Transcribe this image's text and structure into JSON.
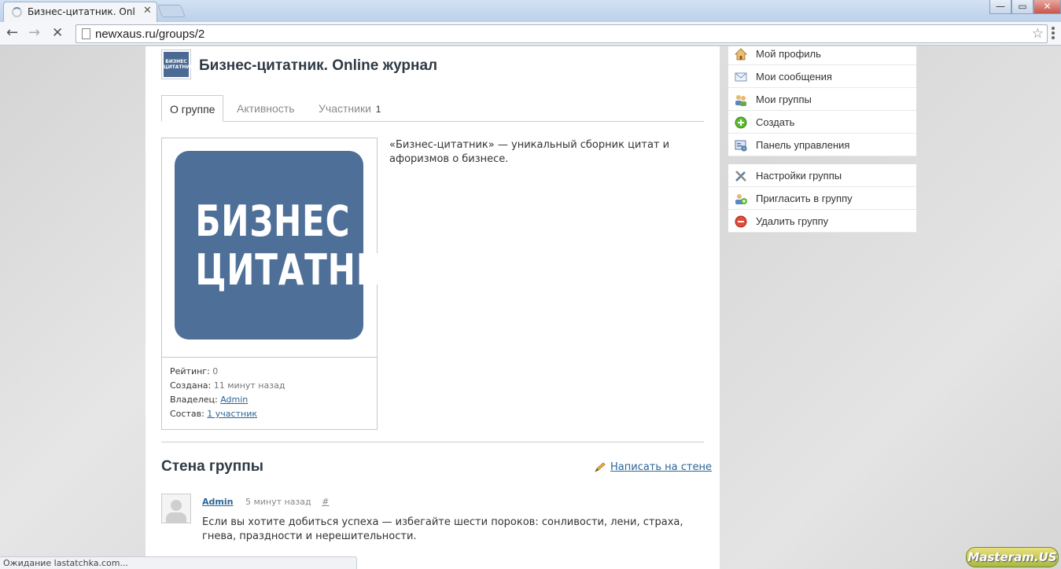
{
  "browser": {
    "tab_title": "Бизнес-цитатник. Online",
    "tab_close": "✕",
    "url": "newxaus.ru/groups/2",
    "status_text": "Ожидание lastatchka.com...",
    "window_controls": {
      "minimize": "—",
      "restore": "▭",
      "close": "✕"
    }
  },
  "group": {
    "logo_small_text": "БИЗНЕС ЦИТАТНИК",
    "title": "Бизнес-цитатник. Online журнал",
    "tabs": [
      {
        "label": "О группе",
        "count": ""
      },
      {
        "label": "Активность",
        "count": ""
      },
      {
        "label": "Участники",
        "count": "1"
      }
    ],
    "big_logo": {
      "line1": "БИЗНЕС",
      "line2": "ЦИТАТНИК"
    },
    "info": {
      "rating_label": "Рейтинг:",
      "rating_value": "0",
      "created_label": "Создана:",
      "created_value": "11 минут назад",
      "owner_label": "Владелец:",
      "owner_value": "Admin",
      "members_label": "Состав:",
      "members_value": "1 участник"
    },
    "description": "«Бизнес-цитатник» — уникальный сборник цитат и афоризмов о бизнесе."
  },
  "wall": {
    "title": "Стена группы",
    "write_link": "Написать на стене",
    "post": {
      "author": "Admin",
      "time": "5 минут назад",
      "hash": "#",
      "text": "Если вы хотите добиться успеха — избегайте шести пороков: сонливости, лени, страха, гнева, праздности и нерешительности."
    }
  },
  "sidebar": {
    "menu1": [
      {
        "label": "Мой профиль",
        "icon": "home-icon"
      },
      {
        "label": "Мои сообщения",
        "icon": "envelope-icon"
      },
      {
        "label": "Мои группы",
        "icon": "users-icon"
      },
      {
        "label": "Создать",
        "icon": "plus-circle-icon"
      },
      {
        "label": "Панель управления",
        "icon": "dashboard-icon"
      }
    ],
    "menu2": [
      {
        "label": "Настройки группы",
        "icon": "tools-icon"
      },
      {
        "label": "Пригласить в группу",
        "icon": "user-add-icon"
      },
      {
        "label": "Удалить группу",
        "icon": "delete-circle-icon"
      }
    ]
  },
  "watermark": "Masteram.US",
  "colors": {
    "link": "#2a6496",
    "logo_bg": "#4e6f98",
    "title": "#2f3a45"
  }
}
